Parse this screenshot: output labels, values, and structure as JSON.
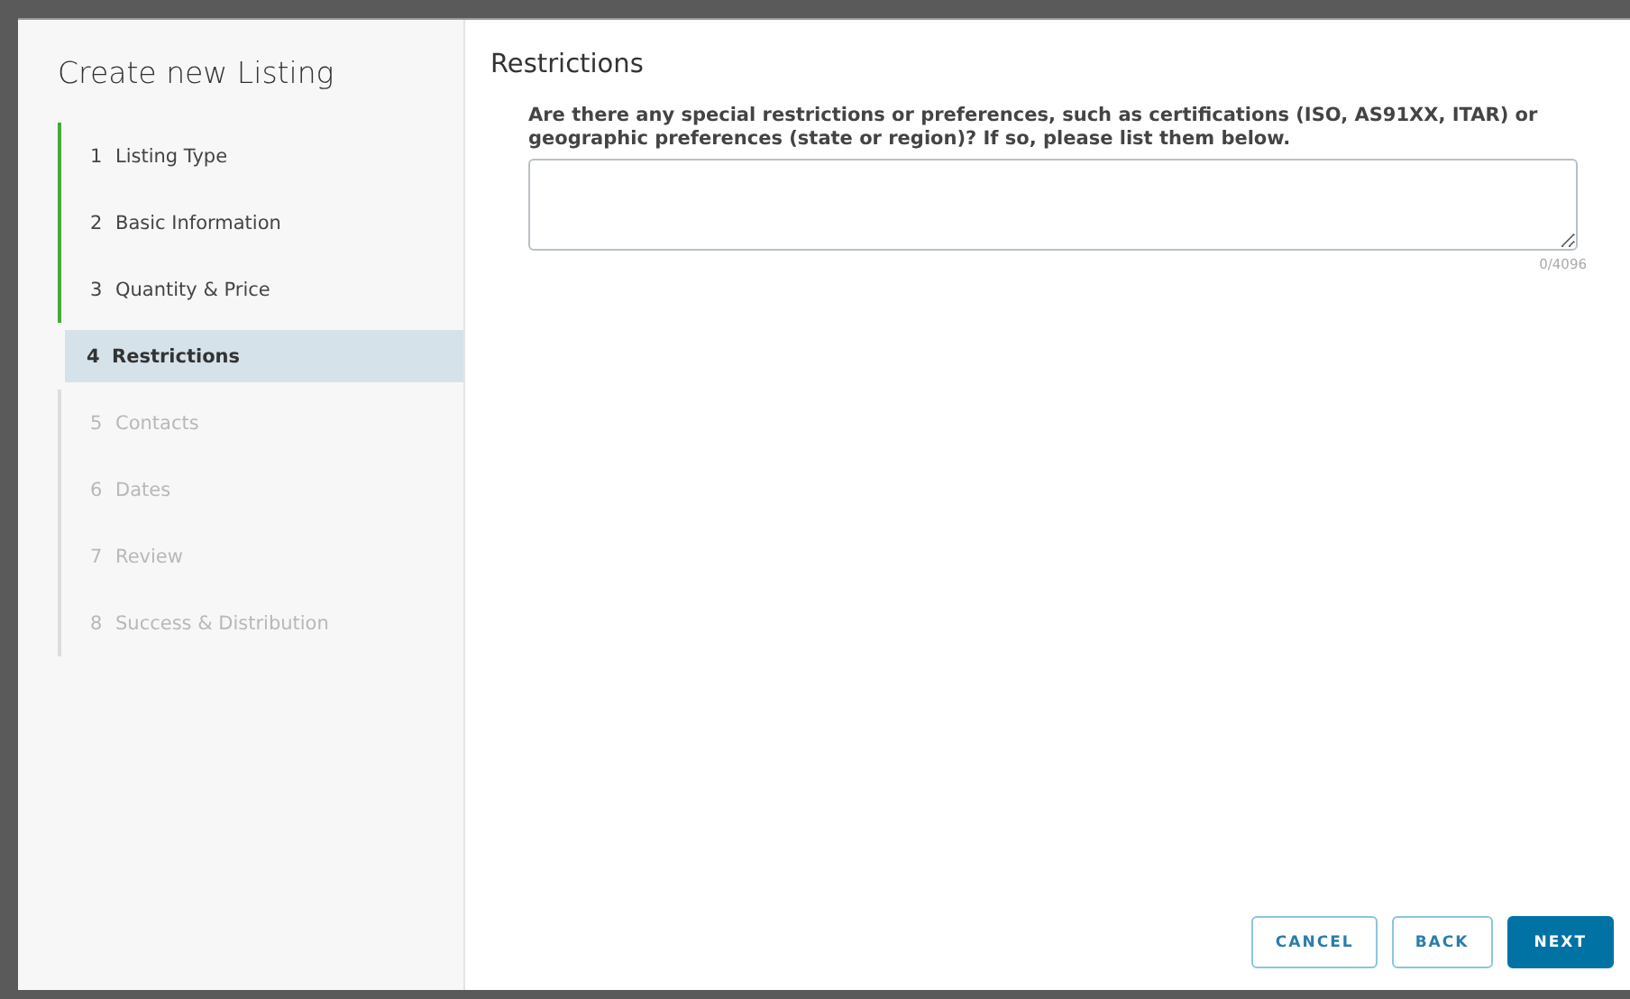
{
  "sidebar": {
    "title": "Create new Listing",
    "steps": [
      {
        "number": "1",
        "label": "Listing Type",
        "completed": true,
        "disabled": false,
        "selected": false
      },
      {
        "number": "2",
        "label": "Basic Information",
        "completed": true,
        "disabled": false,
        "selected": false
      },
      {
        "number": "3",
        "label": "Quantity & Price",
        "completed": true,
        "disabled": false,
        "selected": false
      },
      {
        "number": "4",
        "label": "Restrictions",
        "completed": false,
        "disabled": false,
        "selected": true
      },
      {
        "number": "5",
        "label": "Contacts",
        "completed": false,
        "disabled": true,
        "selected": false
      },
      {
        "number": "6",
        "label": "Dates",
        "completed": false,
        "disabled": true,
        "selected": false
      },
      {
        "number": "7",
        "label": "Review",
        "completed": false,
        "disabled": true,
        "selected": false
      },
      {
        "number": "8",
        "label": "Success & Distribution",
        "completed": false,
        "disabled": true,
        "selected": false
      }
    ]
  },
  "content": {
    "title": "Restrictions",
    "question": "Are there any special restrictions or preferences, such as certifications (ISO, AS91XX, ITAR) or geographic preferences (state or region)? If so, please list them below.",
    "counter": "0/4096"
  },
  "buttons": [
    {
      "label": "CANCEL",
      "kind": "outline"
    },
    {
      "label": "BACK",
      "kind": "outline"
    },
    {
      "label": "NEXT",
      "kind": "primary"
    }
  ]
}
